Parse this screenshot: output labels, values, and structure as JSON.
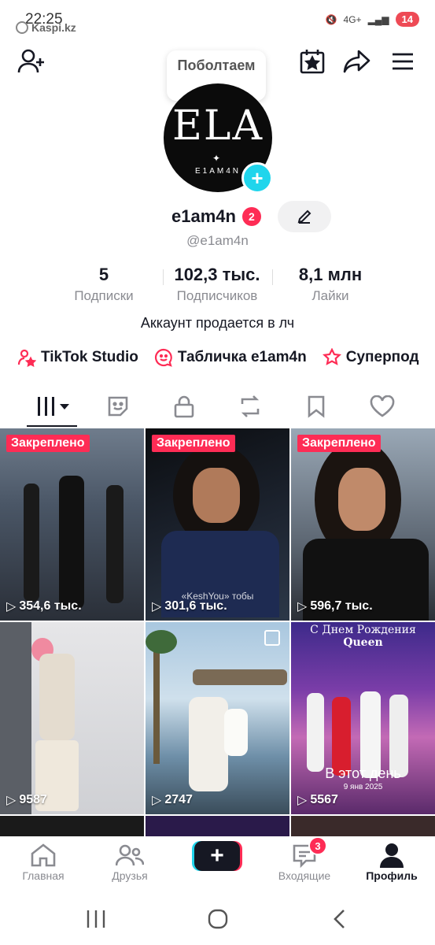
{
  "status_bar": {
    "time": "22:25",
    "carrier_app": "Kaspi.kz",
    "network": "4G+",
    "battery": "14"
  },
  "header": {
    "tooltip": "Поболтаем"
  },
  "profile": {
    "avatar_text": "ELA",
    "avatar_subtext": "E1AM4N",
    "username": "e1am4n",
    "notifications": "2",
    "handle": "@e1am4n",
    "stats": [
      {
        "value": "5",
        "label": "Подписки"
      },
      {
        "value": "102,3 тыс.",
        "label": "Подписчиков"
      },
      {
        "value": "8,1 млн",
        "label": "Лайки"
      }
    ],
    "bio": "Аккаунт продается в лч",
    "links": [
      {
        "label": "TikTok Studio"
      },
      {
        "label": "Табличка e1am4n"
      },
      {
        "label": "Суперпод"
      }
    ]
  },
  "videos": [
    {
      "pinned": "Закреплено",
      "views": "354,6 тыс."
    },
    {
      "pinned": "Закреплено",
      "views": "301,6 тыс.",
      "caption": "«KeshYou» тобы"
    },
    {
      "pinned": "Закреплено",
      "views": "596,7 тыс."
    },
    {
      "views": "9587"
    },
    {
      "views": "2747"
    },
    {
      "views": "5567",
      "title": "С Днем Рождения",
      "title2": "Queen",
      "caption": "В этот день",
      "date": "9 янв 2025"
    }
  ],
  "bottom_nav": {
    "home": "Главная",
    "friends": "Друзья",
    "inbox": "Входящие",
    "inbox_badge": "3",
    "profile": "Профиль"
  },
  "colors": {
    "accent": "#fe2c55",
    "cyan": "#20d5ec",
    "text": "#161823",
    "muted": "#8a8b91"
  }
}
